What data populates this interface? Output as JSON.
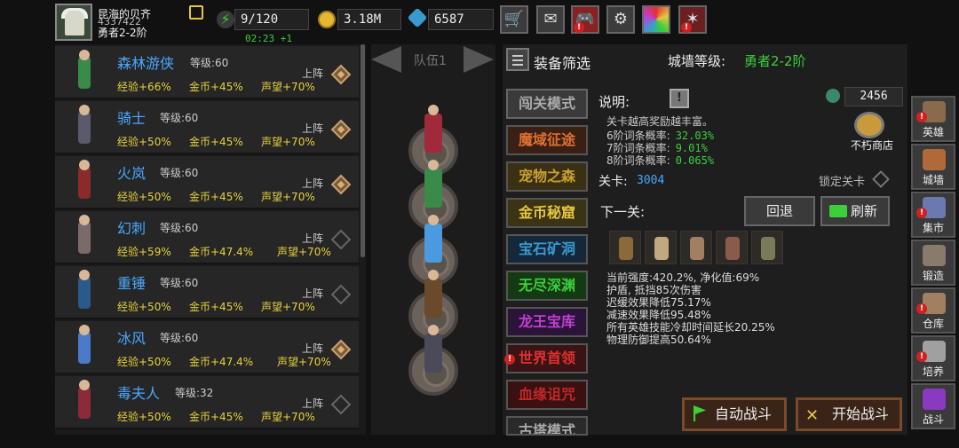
{
  "player": {
    "name": "昆海的贝齐",
    "id": "4337422",
    "rank": "勇者2-2阶"
  },
  "resources": {
    "energy": "9/120",
    "energy_timer": "02:23 +1",
    "gold": "3.18M",
    "gems": "6587"
  },
  "top_buttons": [
    "cart-icon",
    "mail-icon",
    "gamepad-icon",
    "settings-icon",
    "color-wheel-icon",
    "sparkle-icon"
  ],
  "heroes": [
    {
      "name": "森林游侠",
      "level": "等级:60",
      "exp": "经验+66%",
      "gold": "金币+45%",
      "fame": "声望+70%",
      "deploy": "上阵",
      "deployed": true,
      "color": "#3a8a4a"
    },
    {
      "name": "骑士",
      "level": "等级:60",
      "exp": "经验+50%",
      "gold": "金币+45%",
      "fame": "声望+70%",
      "deploy": "上阵",
      "deployed": true,
      "color": "#5a5a6a"
    },
    {
      "name": "火岚",
      "level": "等级:60",
      "exp": "经验+50%",
      "gold": "金币+45%",
      "fame": "声望+70%",
      "deploy": "上阵",
      "deployed": true,
      "color": "#8a2a2a"
    },
    {
      "name": "幻刺",
      "level": "等级:60",
      "exp": "经验+59%",
      "gold": "金币+47.4%",
      "fame": "声望+70%",
      "deploy": "上阵",
      "deployed": false,
      "color": "#7a6a6a"
    },
    {
      "name": "重锤",
      "level": "等级:60",
      "exp": "经验+50%",
      "gold": "金币+45%",
      "fame": "声望+70%",
      "deploy": "上阵",
      "deployed": false,
      "color": "#2a5a8a"
    },
    {
      "name": "冰风",
      "level": "等级:60",
      "exp": "经验+50%",
      "gold": "金币+47.4%",
      "fame": "声望+70%",
      "deploy": "上阵",
      "deployed": true,
      "color": "#4a7ac8"
    },
    {
      "name": "毒夫人",
      "level": "等级:32",
      "exp": "经验+50%",
      "gold": "金币+45%",
      "fame": "声望+70%",
      "deploy": "上阵",
      "deployed": false,
      "color": "#8a2a3a"
    }
  ],
  "team": {
    "label": "队伍1",
    "members": [
      "#a02a3a",
      "#3a8a4a",
      "#4a9ae0",
      "#6a4a2a",
      "#4a4a5a"
    ]
  },
  "filter": {
    "label": "装备筛选"
  },
  "wall": {
    "label": "城墙等级:",
    "value": "勇者2-2阶"
  },
  "modes": [
    {
      "label": "闯关模式",
      "color": "#aaa",
      "bg": "#3a3a3a"
    },
    {
      "label": "魔域征途",
      "color": "#e07030",
      "bg": "#3a2014"
    },
    {
      "label": "宠物之森",
      "color": "#c9a030",
      "bg": "#3a3014"
    },
    {
      "label": "金币秘窟",
      "color": "#e6c640",
      "bg": "#3a3414"
    },
    {
      "label": "宝石矿洞",
      "color": "#3a9ad0",
      "bg": "#14283a"
    },
    {
      "label": "无尽深渊",
      "color": "#3ccf3c",
      "bg": "#143a14"
    },
    {
      "label": "龙王宝库",
      "color": "#c040d0",
      "bg": "#2a143a"
    },
    {
      "label": "世界首领",
      "color": "#e03030",
      "bg": "#3a1414"
    },
    {
      "label": "血缘诅咒",
      "color": "#c02828",
      "bg": "#3a1010"
    },
    {
      "label": "古塔模式",
      "color": "#aaa",
      "bg": "#2a2a2a"
    }
  ],
  "description": {
    "title": "说明:",
    "info": "!",
    "intro": "关卡越高奖励越丰富。",
    "rows": [
      {
        "label": "6阶词条概率:",
        "value": "32.03%"
      },
      {
        "label": "7阶词条概率:",
        "value": "9.01%"
      },
      {
        "label": "8阶词条概率:",
        "value": "0.065%"
      }
    ]
  },
  "gem_shop": {
    "count": "2456",
    "label": "不朽商店"
  },
  "stage": {
    "label": "关卡:",
    "value": "3004",
    "lock_label": "锁定关卡"
  },
  "next": {
    "label": "下一关:",
    "back": "回退",
    "refresh": "刷新"
  },
  "enemies": [
    "#8a6a3a",
    "#c0a880",
    "#a08060",
    "#8a5a4a",
    "#7a7a5a"
  ],
  "stats": [
    "当前强度:420.2%, 净化值:69%",
    "护盾, 抵挡85次伤害",
    "迟缓效果降低75.17%",
    "减速效果降低95.48%",
    "所有英雄技能冷却时间延长20.25%",
    "物理防御提高50.64%"
  ],
  "battle": {
    "auto": "自动战斗",
    "start": "开始战斗"
  },
  "side_nav": [
    {
      "label": "英雄",
      "icon": "hero-icon",
      "color": "#8a6a4a",
      "badge": true
    },
    {
      "label": "城墙",
      "icon": "wall-icon",
      "color": "#b06a3a",
      "badge": false
    },
    {
      "label": "集市",
      "icon": "market-icon",
      "color": "#6a7ab0",
      "badge": true
    },
    {
      "label": "锻造",
      "icon": "anvil-icon",
      "color": "#8a7a6a",
      "badge": false
    },
    {
      "label": "仓库",
      "icon": "warehouse-icon",
      "color": "#a08060",
      "badge": true
    },
    {
      "label": "培养",
      "icon": "training-icon",
      "color": "#a0a0a0",
      "badge": true
    },
    {
      "label": "战斗",
      "icon": "portal-icon",
      "color": "#8a3ac0",
      "badge": false
    }
  ]
}
